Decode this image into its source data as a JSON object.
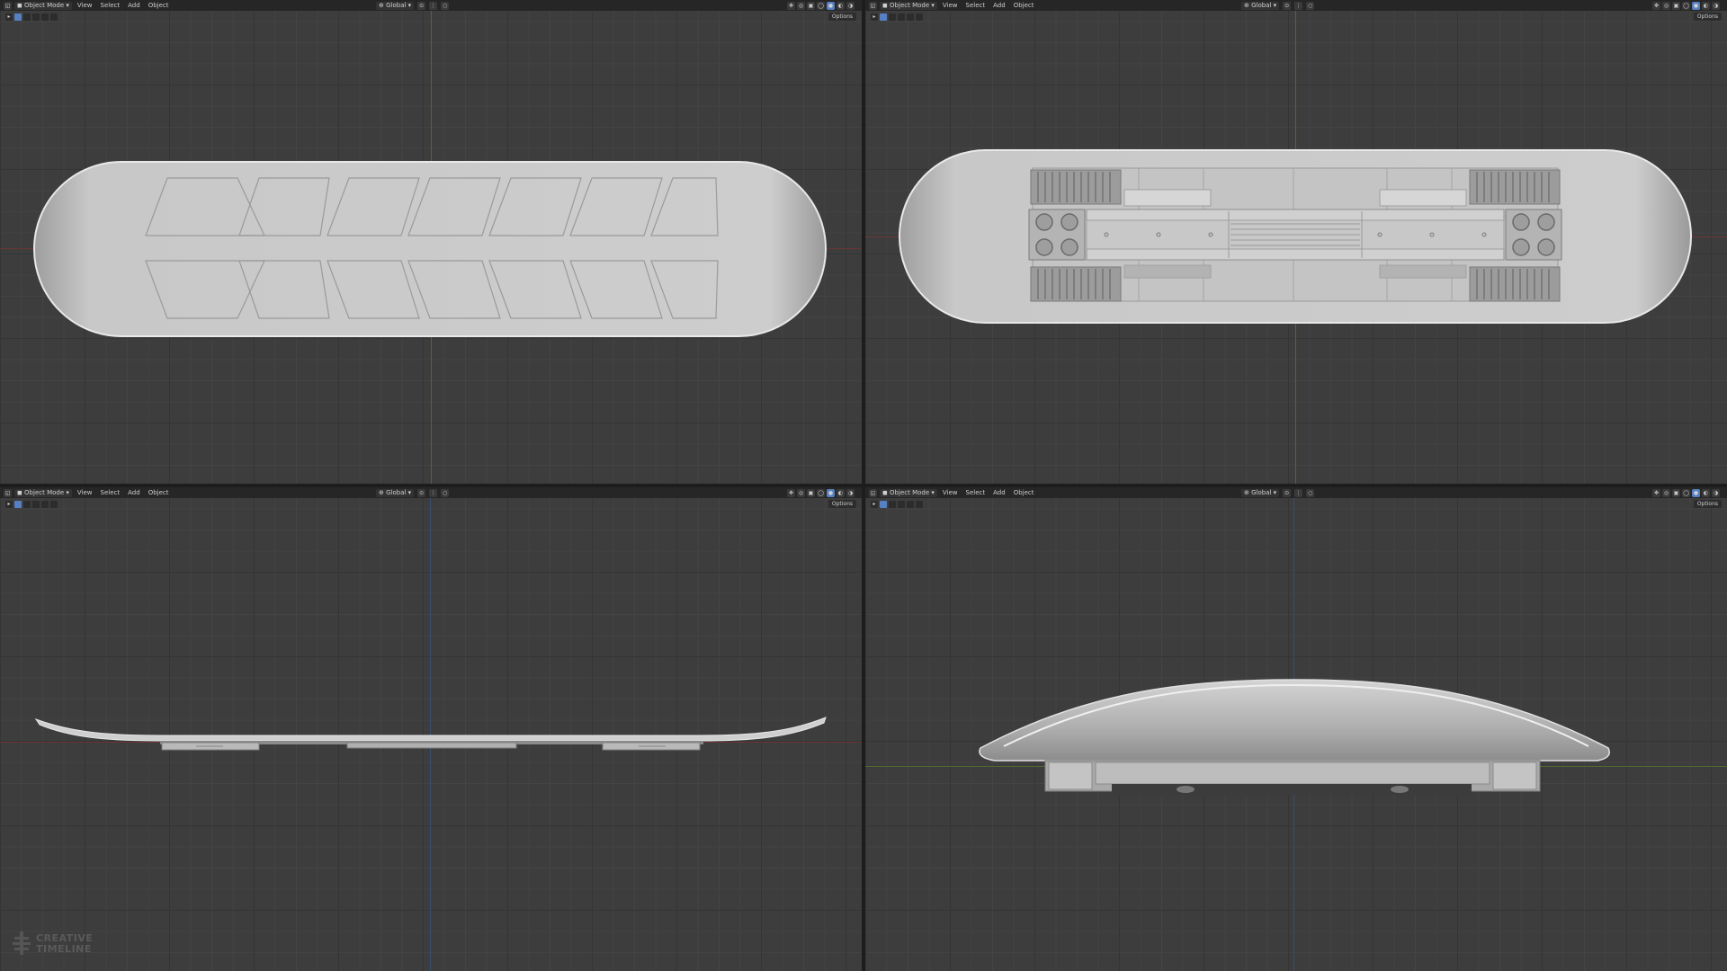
{
  "viewports": [
    {
      "name": "top-left",
      "header": {
        "mode": "Object Mode",
        "menus": [
          "View",
          "Select",
          "Add",
          "Object"
        ],
        "transform_orientation": "Global"
      },
      "options_label": "Options"
    },
    {
      "name": "top-right",
      "header": {
        "mode": "Object Mode",
        "menus": [
          "View",
          "Select",
          "Add",
          "Object"
        ],
        "transform_orientation": "Global"
      },
      "options_label": "Options"
    },
    {
      "name": "bottom-left",
      "header": {
        "mode": "Object Mode",
        "menus": [
          "View",
          "Select",
          "Add",
          "Object"
        ],
        "transform_orientation": "Global"
      },
      "options_label": "Options"
    },
    {
      "name": "bottom-right",
      "header": {
        "mode": "Object Mode",
        "menus": [
          "View",
          "Select",
          "Add",
          "Object"
        ],
        "transform_orientation": "Global"
      },
      "options_label": "Options"
    }
  ],
  "watermark": {
    "line1": "CREATIVE",
    "line2": "TIMELINE"
  },
  "colors": {
    "viewport_bg": "#3d3d3d",
    "header_bg": "#262626",
    "model_light": "#c9c9c9",
    "model_shadow": "#9a9a9a",
    "axis_x": "#6b3434",
    "axis_y": "#4f6b2e",
    "axis_z": "#3b4e70",
    "accent_blue": "#5680c2"
  },
  "icons": [
    "editor-type-icon",
    "object-mode-icon",
    "global-orientation-icon",
    "pivot-icon",
    "snap-icon",
    "proportional-editing-icon",
    "gizmo-icon",
    "overlay-icon",
    "xray-icon",
    "shading-solid-icon",
    "shading-material-icon",
    "shading-rendered-icon",
    "shading-wireframe-icon"
  ]
}
